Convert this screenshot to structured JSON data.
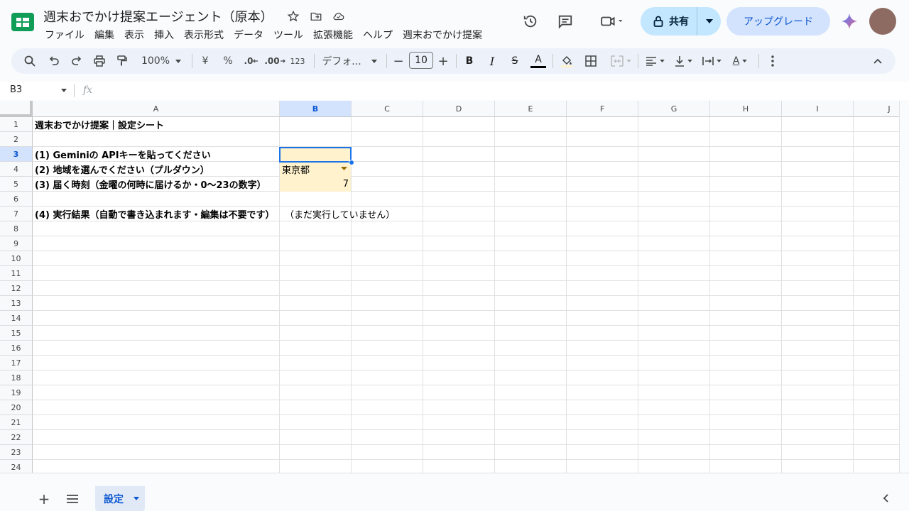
{
  "document": {
    "title": "週末おでかけ提案エージェント（原本）"
  },
  "menu": [
    "ファイル",
    "編集",
    "表示",
    "挿入",
    "表示形式",
    "データ",
    "ツール",
    "拡張機能",
    "ヘルプ",
    "週末おでかけ提案"
  ],
  "header_buttons": {
    "share_label": "共有",
    "upgrade_label": "アップグレード"
  },
  "toolbar": {
    "zoom": "100%",
    "currency": "¥",
    "percent": "%",
    "decrease_decimal": ".0",
    "increase_decimal": ".00",
    "number_format": "123",
    "font_family": "デフォ...",
    "font_size": "10",
    "minus": "−",
    "plus": "+",
    "bold": "B",
    "italic": "I",
    "strikethrough": "S",
    "text_color": "A",
    "text_rotation": "A"
  },
  "formula_bar": {
    "cell_ref": "B3",
    "fx_label": "fx",
    "value": ""
  },
  "grid": {
    "columns": [
      "A",
      "B",
      "C",
      "D",
      "E",
      "F",
      "G",
      "H",
      "I",
      "J"
    ],
    "selected_column": "B",
    "rows": [
      "1",
      "2",
      "3",
      "4",
      "5",
      "6",
      "7",
      "8",
      "9",
      "10",
      "11",
      "12",
      "13",
      "14",
      "15",
      "16",
      "17",
      "18",
      "19",
      "20",
      "21",
      "22",
      "23",
      "24"
    ],
    "selected_row": "3",
    "cells": {
      "A1": "週末おでかけ提案｜設定シート",
      "A3": "(1) Geminiの APIキーを貼ってください",
      "A4": "(2) 地域を選んでください（プルダウン）",
      "A5": "(3) 届く時刻（金曜の何時に届けるか・0〜23の数字）",
      "A7": "(4) 実行結果（自動で書き込まれます・編集は不要です）",
      "B3": "",
      "B4": "東京都",
      "B5": "7",
      "B7": "（まだ実行していません）"
    }
  },
  "sheets": {
    "active_tab": "設定"
  },
  "colors": {
    "input_fill": "#fff2cc",
    "selection": "#1a73e8",
    "share_bg": "#c2e7ff",
    "upgrade_bg": "#d3e3fd"
  }
}
